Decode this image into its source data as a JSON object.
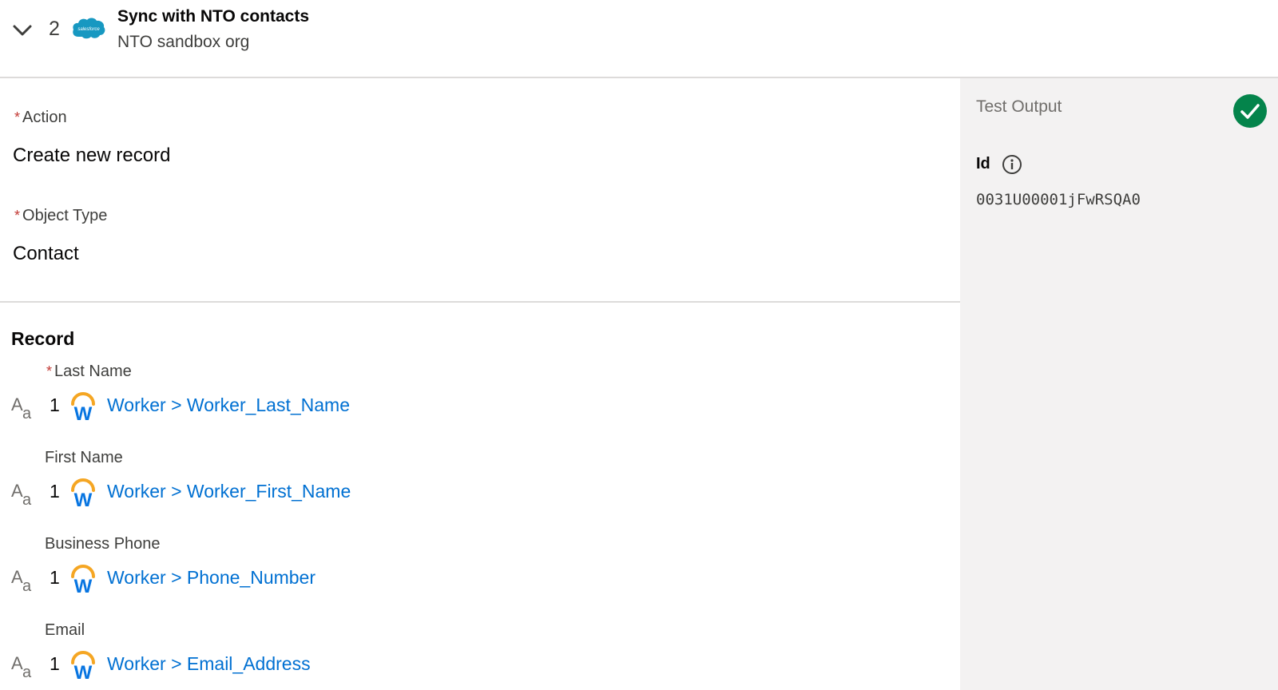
{
  "header": {
    "step_number": "2",
    "title": "Sync with NTO contacts",
    "subtitle": "NTO sandbox org",
    "logo_text": "salesforce",
    "logo_color": "#1798c1"
  },
  "config": {
    "action_label": "Action",
    "action_value": "Create new record",
    "object_type_label": "Object Type",
    "object_type_value": "Contact",
    "required_mark": "*"
  },
  "record": {
    "title": "Record",
    "fields": [
      {
        "label": "Last Name",
        "required": true,
        "count": "1",
        "value": "Worker > Worker_Last_Name"
      },
      {
        "label": "First Name",
        "required": false,
        "count": "1",
        "value": "Worker > Worker_First_Name"
      },
      {
        "label": "Business Phone",
        "required": false,
        "count": "1",
        "value": "Worker > Phone_Number"
      },
      {
        "label": "Email",
        "required": false,
        "count": "1",
        "value": "Worker > Email_Address"
      }
    ]
  },
  "test_output": {
    "title": "Test Output",
    "status": "success",
    "status_color": "#04844b",
    "id_label": "Id",
    "id_value": "0031U00001jFwRSQA0"
  },
  "icons": {
    "collapse": "chevron-down-icon",
    "text_type": "text-type-icon",
    "workday": "workday-logo",
    "success": "check-circle-icon",
    "info": "info-icon"
  },
  "colors": {
    "link": "#0070d2",
    "required": "#c23934",
    "workday_orange": "#f5a623",
    "workday_blue": "#0875e1"
  }
}
